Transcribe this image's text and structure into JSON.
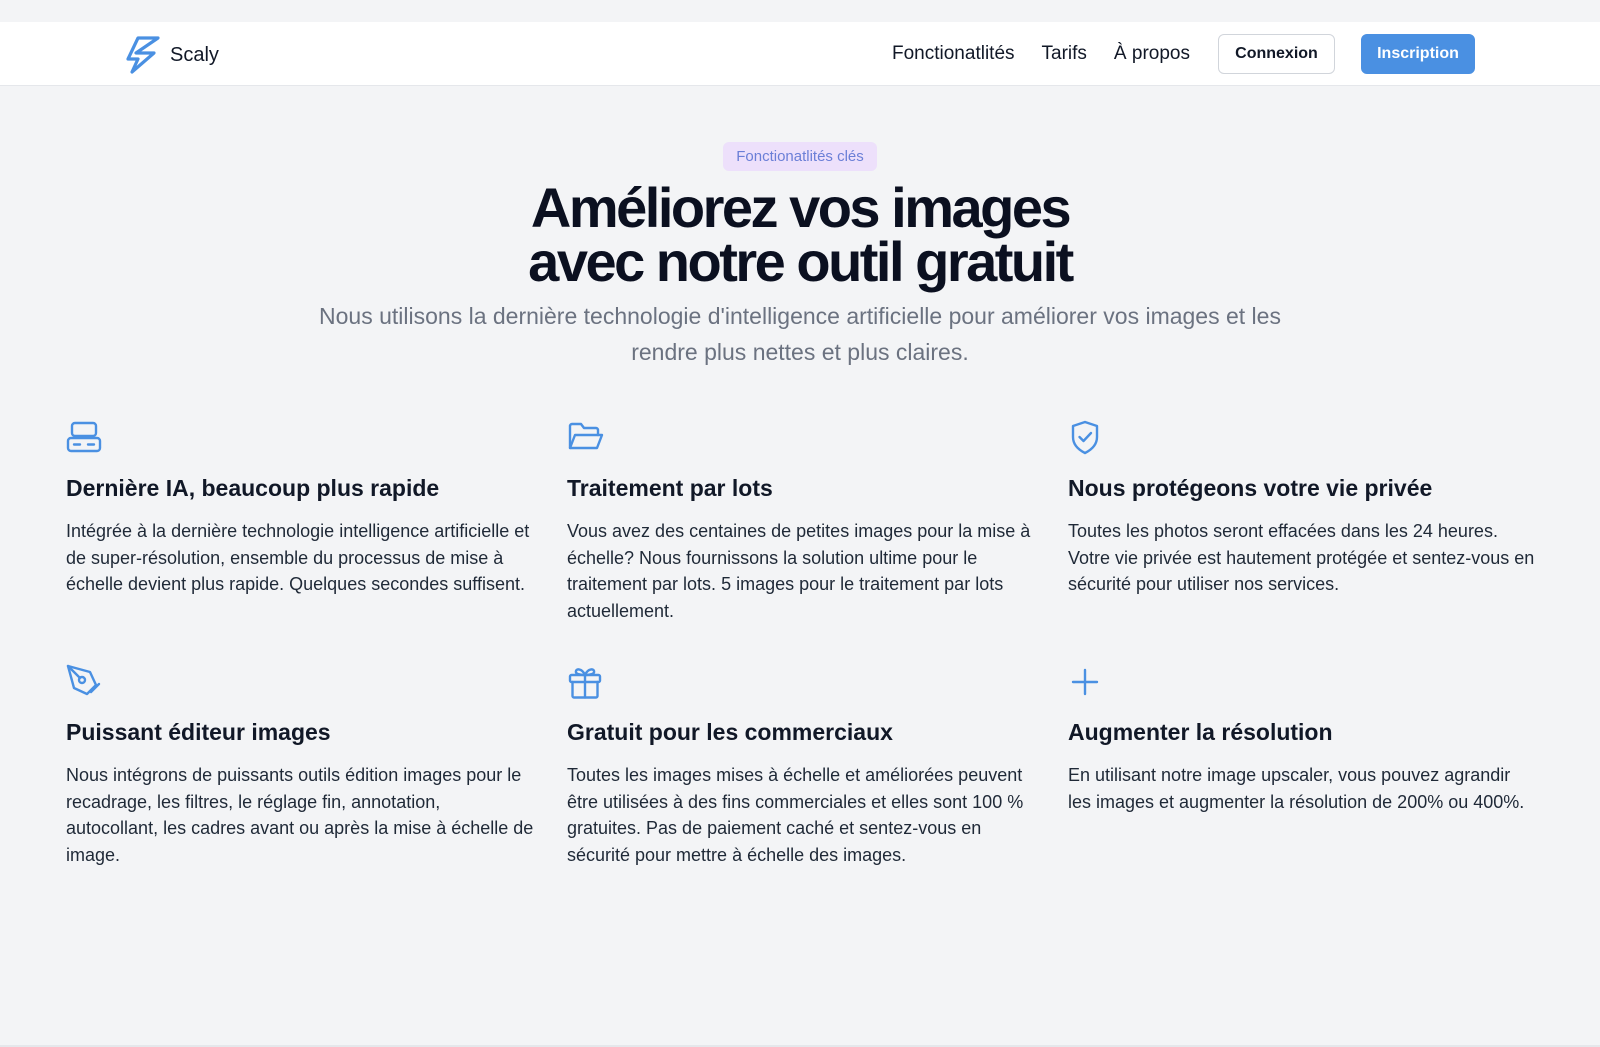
{
  "brand": {
    "name": "Scaly",
    "logo_icon": "lightning-bolt-logo",
    "accent_color": "#4a90e2"
  },
  "nav": {
    "links": [
      "Fonctionatlités",
      "Tarifs",
      "À propos"
    ],
    "login_label": "Connexion",
    "signup_label": "Inscription"
  },
  "hero": {
    "badge": "Fonctionatlités clés",
    "title_line1": "Améliorez vos images",
    "title_line2": "avec notre outil gratuit",
    "subtitle": "Nous utilisons la dernière technologie d'intelligence artificielle pour améliorer vos images et les rendre plus nettes et plus claires."
  },
  "features": [
    {
      "icon": "server-icon",
      "title": "Dernière IA, beaucoup plus rapide",
      "text": "Intégrée à la dernière technologie intelligence artificielle et de super-résolution, ensemble du processus de mise à échelle devient plus rapide. Quelques secondes suffisent."
    },
    {
      "icon": "folder-open-icon",
      "title": "Traitement par lots",
      "text": "Vous avez des centaines de petites images pour la mise à échelle? Nous fournissons la solution ultime pour le traitement par lots. 5 images pour le traitement par lots actuellement."
    },
    {
      "icon": "shield-check-icon",
      "title": "Nous protégeons votre vie privée",
      "text": "Toutes les photos seront effacées dans les 24 heures. Votre vie privée est hautement protégée et sentez-vous en sécurité pour utiliser nos services."
    },
    {
      "icon": "pen-tool-icon",
      "title": "Puissant éditeur images",
      "text": "Nous intégrons de puissants outils édition images pour le recadrage, les filtres, le réglage fin, annotation, autocollant, les cadres avant ou après la mise à échelle de image."
    },
    {
      "icon": "gift-icon",
      "title": "Gratuit pour les commerciaux",
      "text": "Toutes les images mises à échelle et améliorées peuvent être utilisées à des fins commerciales et elles sont 100 % gratuites. Pas de paiement caché et sentez-vous en sécurité pour mettre à échelle des images."
    },
    {
      "icon": "plus-icon",
      "title": "Augmenter la résolution",
      "text": "En utilisant notre image upscaler, vous pouvez agrandir les images et augmenter la résolution de 200% ou 400%."
    }
  ]
}
